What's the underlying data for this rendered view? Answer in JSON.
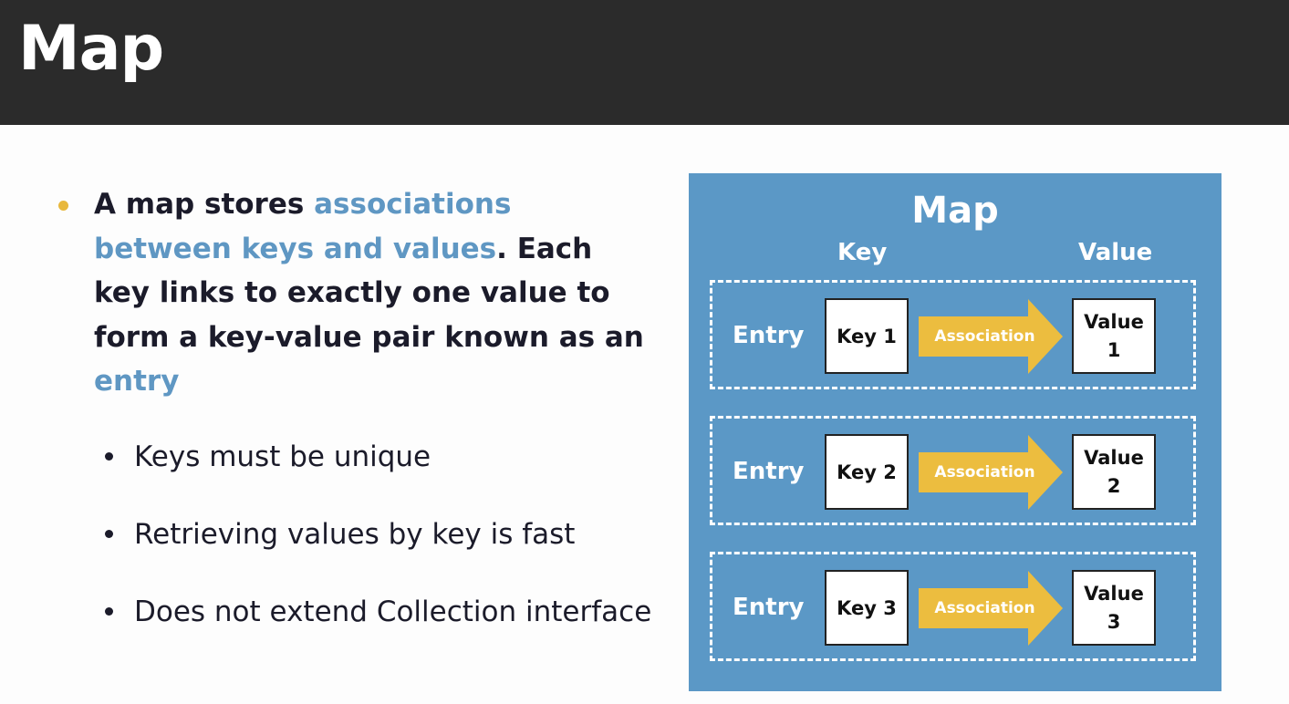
{
  "slide": {
    "title": "Map"
  },
  "bullets": {
    "main": {
      "t1": "A map stores ",
      "h1": "associations between keys and values",
      "t2": ". Each key links to exactly one value to form a key-value pair known as an ",
      "h2": "entry"
    },
    "sub": [
      "Keys must be unique",
      "Retrieving values by key is fast",
      "Does not extend Collection interface"
    ]
  },
  "diagram": {
    "title": "Map",
    "key_header": "Key",
    "value_header": "Value",
    "entries": [
      {
        "label": "Entry",
        "key": "Key 1",
        "association": "Association",
        "value_word": "Value",
        "value_num": "1"
      },
      {
        "label": "Entry",
        "key": "Key 2",
        "association": "Association",
        "value_word": "Value",
        "value_num": "2"
      },
      {
        "label": "Entry",
        "key": "Key 3",
        "association": "Association",
        "value_word": "Value",
        "value_num": "3"
      }
    ]
  },
  "colors": {
    "title_bar": "#2b2b2b",
    "highlight": "#5f97c3",
    "bullet": "#e8b83d",
    "panel": "#5b98c6",
    "arrow": "#ecbd3f"
  }
}
